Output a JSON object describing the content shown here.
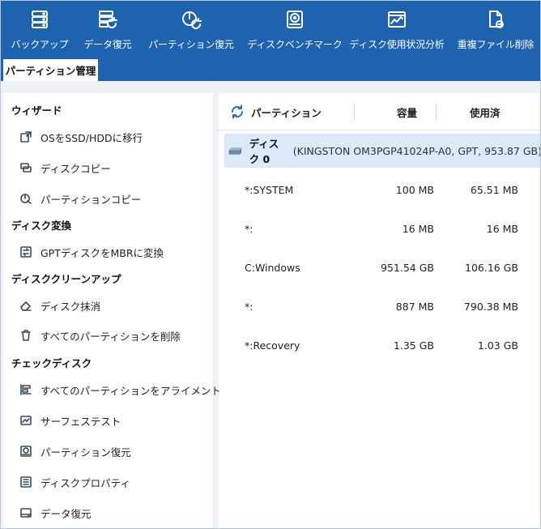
{
  "toolbar": {
    "items": [
      {
        "label": "バックアップ",
        "icon": "backup-icon"
      },
      {
        "label": "データ復元",
        "icon": "data-recovery-icon"
      },
      {
        "label": "パーティション復元",
        "icon": "partition-recovery-icon"
      },
      {
        "label": "ディスクベンチマーク",
        "icon": "disk-benchmark-icon"
      },
      {
        "label": "ディスク使用状況分析",
        "icon": "disk-usage-analysis-icon"
      },
      {
        "label": "重複ファイル削除",
        "icon": "duplicate-file-delete-icon"
      }
    ]
  },
  "tabs": {
    "active": "パーティション管理"
  },
  "sidebar": {
    "sections": [
      {
        "title": "ウィザード",
        "items": [
          "OSをSSD/HDDに移行",
          "ディスクコピー",
          "パーティションコピー"
        ]
      },
      {
        "title": "ディスク変換",
        "items": [
          "GPTディスクをMBRに変換"
        ]
      },
      {
        "title": "ディスククリーンアップ",
        "items": [
          "ディスク抹消",
          "すべてのパーティションを削除"
        ]
      },
      {
        "title": "チェックディスク",
        "items": [
          "すべてのパーティションをアライメント",
          "サーフェステスト",
          "パーティション復元",
          "ディスクプロパティ",
          "データ復元"
        ]
      }
    ]
  },
  "table": {
    "headers": {
      "partition": "パーティション",
      "capacity": "容量",
      "used": "使用済"
    },
    "disk": {
      "name": "ディスク 0",
      "description": "(KINGSTON OM3PGP41024P-A0, GPT, 953.87 GB)"
    },
    "rows": [
      {
        "name": "*:SYSTEM",
        "capacity": "100 MB",
        "used": "65.51 MB"
      },
      {
        "name": "*:",
        "capacity": "16 MB",
        "used": "16 MB"
      },
      {
        "name": "C:Windows",
        "capacity": "951.54 GB",
        "used": "106.16 GB"
      },
      {
        "name": "*:",
        "capacity": "887 MB",
        "used": "790.38 MB"
      },
      {
        "name": "*:Recovery",
        "capacity": "1.35 GB",
        "used": "1.03 GB"
      }
    ]
  },
  "colors": {
    "toolbar_bg": "#1d63b0",
    "selected_row": "#dbe9f8",
    "accent": "#2a6fc0"
  }
}
